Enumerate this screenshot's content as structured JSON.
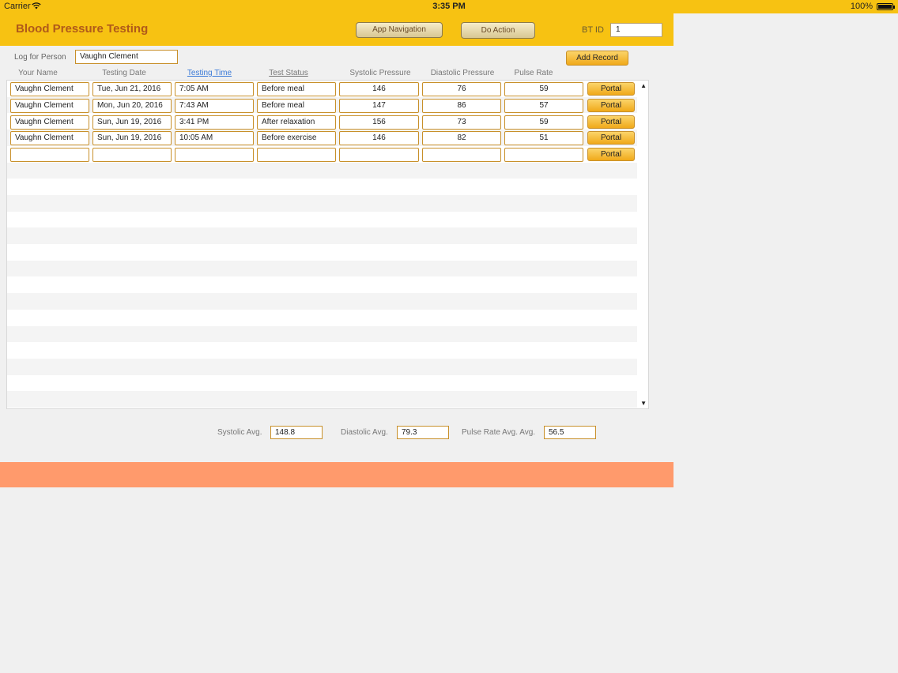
{
  "status_bar": {
    "carrier": "Carrier",
    "time": "3:35 PM",
    "battery": "100%"
  },
  "header": {
    "title": "Blood Pressure Testing",
    "nav_button": "App Navigation",
    "action_button": "Do Action",
    "btid_label": "BT ID",
    "btid_value": "1"
  },
  "log": {
    "label": "Log for Person",
    "value": "Vaughn Clement",
    "add_button": "Add Record"
  },
  "columns": [
    "Your Name",
    "Testing Date",
    "Testing Time",
    "Test Status",
    "Systolic Pressure",
    "Diastolic Pressure",
    "Pulse Rate"
  ],
  "rows": [
    {
      "name": "Vaughn Clement",
      "date": "Tue, Jun 21, 2016",
      "time": "7:05 AM",
      "status": "Before meal",
      "systolic": "146",
      "diastolic": "76",
      "pulse": "59",
      "portal": "Portal"
    },
    {
      "name": "Vaughn Clement",
      "date": "Mon, Jun 20, 2016",
      "time": "7:43 AM",
      "status": "Before meal",
      "systolic": "147",
      "diastolic": "86",
      "pulse": "57",
      "portal": "Portal"
    },
    {
      "name": "Vaughn Clement",
      "date": "Sun, Jun 19, 2016",
      "time": "3:41 PM",
      "status": "After relaxation",
      "systolic": "156",
      "diastolic": "73",
      "pulse": "59",
      "portal": "Portal"
    },
    {
      "name": "Vaughn Clement",
      "date": "Sun, Jun 19, 2016",
      "time": "10:05 AM",
      "status": "Before exercise",
      "systolic": "146",
      "diastolic": "82",
      "pulse": "51",
      "portal": "Portal"
    },
    {
      "name": "",
      "date": "",
      "time": "",
      "status": "",
      "systolic": "",
      "diastolic": "",
      "pulse": "",
      "portal": "Portal"
    }
  ],
  "averages": {
    "systolic_label": "Systolic Avg.",
    "systolic_value": "148.8",
    "diastolic_label": "Diastolic Avg.",
    "diastolic_value": "79.3",
    "pulse_label": "Pulse Rate Avg. Avg.",
    "pulse_value": "56.5"
  },
  "colors": {
    "header": "#f7c212",
    "title": "#b05a1a",
    "footer": "#ff9a6c",
    "field_border": "#c8902a",
    "link_blue": "#3a7ad8"
  }
}
